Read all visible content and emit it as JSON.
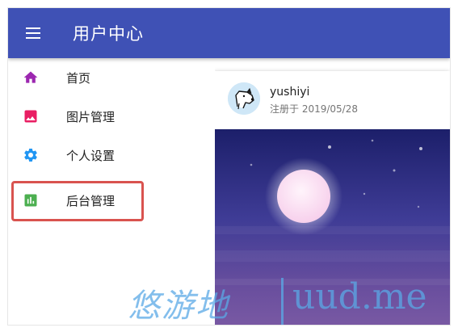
{
  "app": {
    "title": "用户中心",
    "primary_color": "#3f51b5"
  },
  "drawer": {
    "items": [
      {
        "label": "首页",
        "icon": "home-icon",
        "color": "#9c27b0"
      },
      {
        "label": "图片管理",
        "icon": "image-icon",
        "color": "#e91e63"
      },
      {
        "label": "个人设置",
        "icon": "gear-icon",
        "color": "#2196f3"
      },
      {
        "label": "后台管理",
        "icon": "bar-chart-icon",
        "color": "#4caf50"
      }
    ],
    "highlighted_item": "后台管理",
    "highlight_color": "#d9534f"
  },
  "card": {
    "username": "yushiyi",
    "register_date": "注册于 2019/05/28",
    "avatar": "dog-sketch-avatar",
    "media": "moon-night-sky"
  },
  "watermark": {
    "chinese": "悠游地",
    "site": "uud.me",
    "color": "#5aa9e6"
  }
}
